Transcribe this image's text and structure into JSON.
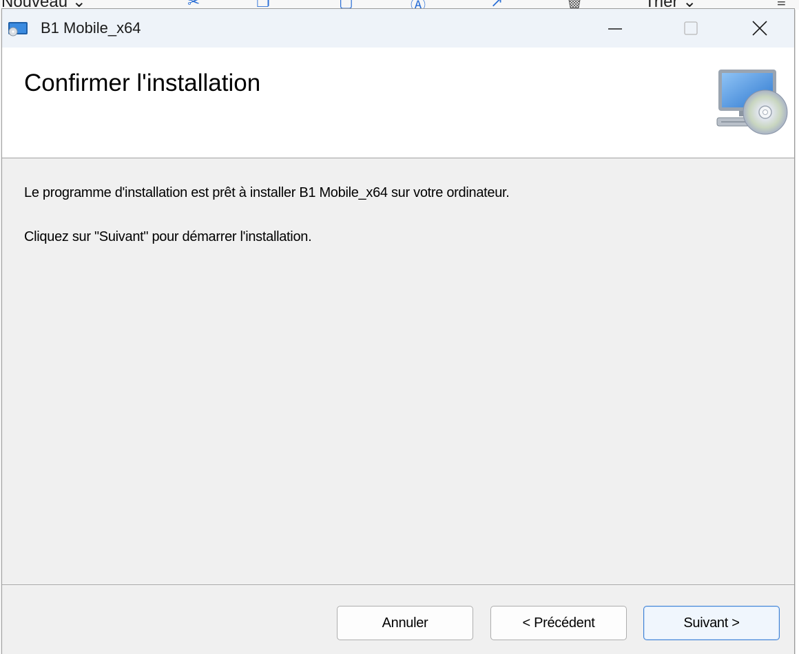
{
  "background": {
    "items": [
      {
        "name": "new-button",
        "label": "Nouveau ⌄"
      },
      {
        "name": "sort-button",
        "label": "Trier ⌄"
      }
    ]
  },
  "window": {
    "title": "B1 Mobile_x64",
    "icon": "installer-app-icon",
    "controls": {
      "minimize_icon": "minimize-icon",
      "maximize_icon": "maximize-icon",
      "close_icon": "close-icon"
    }
  },
  "header": {
    "title": "Confirmer l'installation",
    "icon": "computer-cd-icon"
  },
  "content": {
    "message_ready": "Le programme d'installation est prêt à installer B1 Mobile_x64 sur votre ordinateur.",
    "message_instruction": "Cliquez sur \"Suivant\" pour démarrer l'installation."
  },
  "buttons": {
    "cancel": "Annuler",
    "previous": "< Précédent",
    "next": "Suivant >"
  },
  "colors": {
    "titlebar_bg": "#eef3f9",
    "dialog_bg": "#f0f0f0",
    "header_bg": "#ffffff",
    "default_button_border": "#3a7fd6"
  }
}
